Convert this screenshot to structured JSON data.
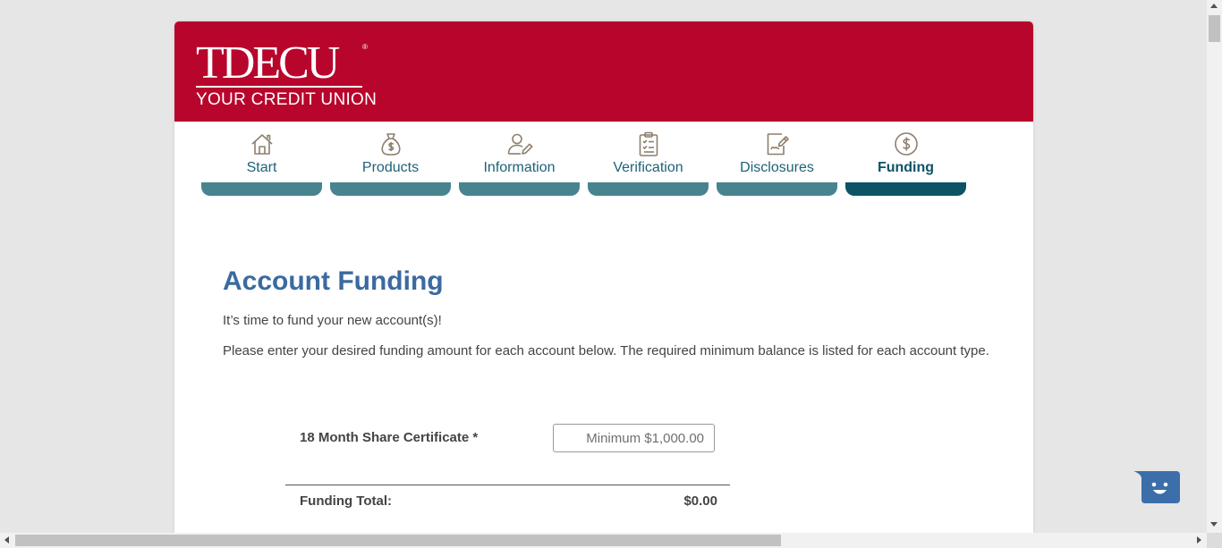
{
  "header": {
    "logo_text": "TDECU",
    "logo_mark": "®",
    "logo_subtitle": "YOUR CREDIT UNION",
    "background": "#b8052c"
  },
  "steps": [
    {
      "label": "Start",
      "icon": "house-icon",
      "active": false
    },
    {
      "label": "Products",
      "icon": "money-bag-icon",
      "active": false
    },
    {
      "label": "Information",
      "icon": "user-edit-icon",
      "active": false
    },
    {
      "label": "Verification",
      "icon": "clipboard-checklist-icon",
      "active": false
    },
    {
      "label": "Disclosures",
      "icon": "document-sign-icon",
      "active": false
    },
    {
      "label": "Funding",
      "icon": "dollar-circle-icon",
      "active": true
    }
  ],
  "main": {
    "title": "Account Funding",
    "intro": "It’s time to fund your new account(s)!",
    "instructions": "Please enter your desired funding amount for each account below. The required minimum balance is listed for each account type.",
    "accounts": [
      {
        "label": "18 Month Share Certificate *",
        "value": "",
        "placeholder": "Minimum $1,000.00"
      }
    ],
    "total_label": "Funding Total:",
    "total_value": "$0.00"
  },
  "colors": {
    "brand_red": "#b8052c",
    "title_blue": "#3b6aa0",
    "step_bar": "#48848f",
    "step_bar_active": "#0d5366",
    "chat_button": "#3c6eaa"
  }
}
